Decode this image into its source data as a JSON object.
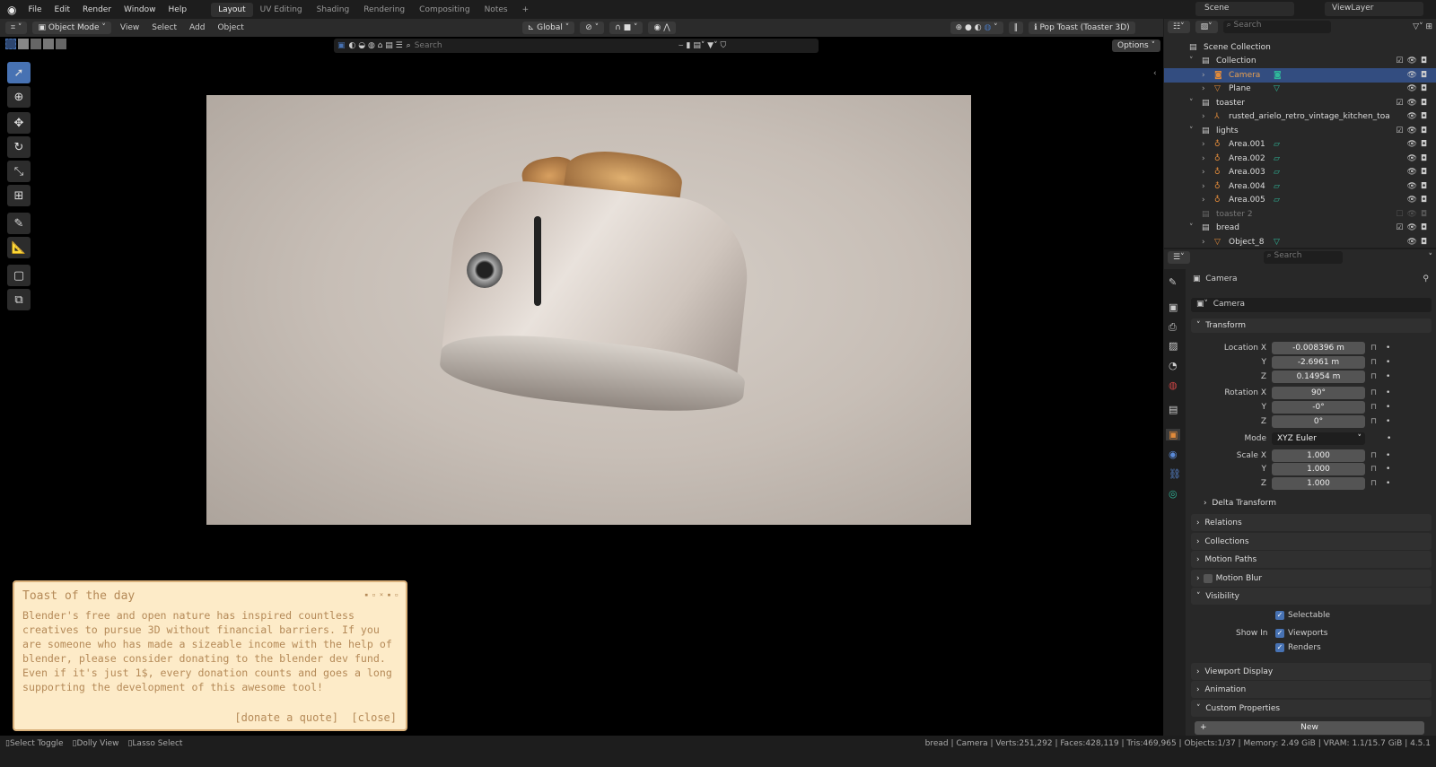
{
  "menu": [
    "File",
    "Edit",
    "Render",
    "Window",
    "Help"
  ],
  "workspaces": [
    "Layout",
    "UV Editing",
    "Shading",
    "Rendering",
    "Compositing",
    "Notes",
    "+"
  ],
  "header": {
    "mode": "Object Mode",
    "menus": [
      "View",
      "Select",
      "Add",
      "Object"
    ],
    "orientation": "Global",
    "search_placeholder": "Search",
    "options": "Options",
    "scene_label": "Pop Toast (Toaster 3D)"
  },
  "scene": {
    "scene": "Scene",
    "view_layer": "ViewLayer"
  },
  "outliner": {
    "search_placeholder": "Search",
    "rows": [
      {
        "name": "Scene Collection",
        "indent": 0,
        "type": "collection"
      },
      {
        "name": "Collection",
        "indent": 1,
        "type": "collection",
        "checked": true
      },
      {
        "name": "Camera",
        "indent": 2,
        "type": "camera",
        "selected": true
      },
      {
        "name": "Plane",
        "indent": 2,
        "type": "mesh"
      },
      {
        "name": "toaster",
        "indent": 1,
        "type": "collection",
        "checked": true
      },
      {
        "name": "rusted_arielo_retro_vintage_kitchen_toa",
        "indent": 2,
        "type": "empty"
      },
      {
        "name": "lights",
        "indent": 1,
        "type": "collection",
        "checked": true
      },
      {
        "name": "Area.001",
        "indent": 2,
        "type": "light"
      },
      {
        "name": "Area.002",
        "indent": 2,
        "type": "light"
      },
      {
        "name": "Area.003",
        "indent": 2,
        "type": "light"
      },
      {
        "name": "Area.004",
        "indent": 2,
        "type": "light"
      },
      {
        "name": "Area.005",
        "indent": 2,
        "type": "light"
      },
      {
        "name": "toaster 2",
        "indent": 1,
        "type": "collection",
        "disabled": true
      },
      {
        "name": "bread",
        "indent": 1,
        "type": "collection",
        "checked": true
      },
      {
        "name": "Object_8",
        "indent": 2,
        "type": "mesh"
      }
    ]
  },
  "properties": {
    "search_placeholder": "Search",
    "object": "Camera",
    "object_name": "Camera",
    "transform": "Transform",
    "location": {
      "label": "Location X",
      "x": "-0.008396 m",
      "y": "-2.6961 m",
      "z": "0.14954 m"
    },
    "rotation": {
      "label": "Rotation X",
      "x": "90°",
      "y": "-0°",
      "z": "0°"
    },
    "mode_label": "Mode",
    "mode": "XYZ Euler",
    "scale": {
      "label": "Scale X",
      "x": "1.000",
      "y": "1.000",
      "z": "1.000"
    },
    "axis": {
      "y": "Y",
      "z": "Z"
    },
    "delta": "Delta Transform",
    "sections": [
      "Relations",
      "Collections",
      "Motion Paths",
      "Motion Blur",
      "Visibility"
    ],
    "selectable": "Selectable",
    "show_in": "Show In",
    "viewports": "Viewports",
    "renders": "Renders",
    "sections2": [
      "Viewport Display",
      "Animation",
      "Custom Properties"
    ],
    "new": "New"
  },
  "toast": {
    "title": "Toast of the day",
    "body": "Blender's free and open nature has inspired countless creatives to pursue 3D without financial barriers. If you are someone who has made a sizeable income with the help of blender, please consider donating to the blender dev fund. Even if it's just 1$, every donation counts and goes a long supporting the development of this awesome tool!",
    "donate": "[donate a quote]",
    "close": "[close]"
  },
  "status": {
    "hints": [
      "Select Toggle",
      "Dolly View",
      "Lasso Select"
    ],
    "info": "bread | Camera | Verts:251,292 | Faces:428,119 | Tris:469,965 | Objects:1/37 | Memory: 2.49 GiB | VRAM: 1.1/15.7 GiB | 4.5.1"
  },
  "colors": {
    "accent": "#4772b3",
    "selected_row": "#334d80",
    "object_orange": "#e08a3a",
    "data_green": "#2fb89a",
    "toast_bg": "#fdebc8",
    "toast_text": "#b58a58"
  }
}
